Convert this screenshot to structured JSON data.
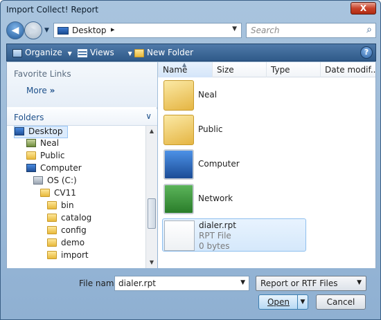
{
  "window": {
    "title": "Import Collect! Report",
    "close_label": "X"
  },
  "nav": {
    "back_glyph": "◀",
    "forward_glyph": "▶",
    "dropdown_glyph": "▼",
    "address": "Desktop",
    "address_separator": "▸",
    "refresh_glyph": "↻",
    "search_placeholder": "Search",
    "search_glyph": "⌕"
  },
  "toolbar": {
    "organize_label": "Organize",
    "views_label": "Views",
    "new_folder_label": "New Folder",
    "menu_glyph": "▼",
    "help_glyph": "?"
  },
  "left": {
    "favorites_title": "Favorite Links",
    "more_label": "More",
    "more_glyph": "»",
    "folders_title": "Folders",
    "folders_chevron": "∨",
    "tree": [
      {
        "label": "Desktop",
        "icon": "desktop-icon"
      },
      {
        "label": "Neal",
        "icon": "user-folder-icon"
      },
      {
        "label": "Public",
        "icon": "folder-icon"
      },
      {
        "label": "Computer",
        "icon": "computer-icon"
      },
      {
        "label": "OS (C:)",
        "icon": "drive-icon"
      },
      {
        "label": "CV11",
        "icon": "folder-icon"
      },
      {
        "label": "bin",
        "icon": "folder-icon"
      },
      {
        "label": "catalog",
        "icon": "folder-icon"
      },
      {
        "label": "config",
        "icon": "folder-icon"
      },
      {
        "label": "demo",
        "icon": "folder-icon"
      },
      {
        "label": "import",
        "icon": "folder-icon"
      }
    ],
    "scroll_up": "▲",
    "scroll_down": "▼"
  },
  "right": {
    "columns": [
      "Name",
      "Size",
      "Type",
      "Date modif..."
    ],
    "sort_glyph": "▲",
    "files": [
      {
        "name": "Neal",
        "icon": "user-folder-icon"
      },
      {
        "name": "Public",
        "icon": "folder-icon"
      },
      {
        "name": "Computer",
        "icon": "computer-icon"
      },
      {
        "name": "Network",
        "icon": "network-icon"
      },
      {
        "name": "dialer.rpt",
        "type": "RPT File",
        "size": "0 bytes",
        "icon": "document-icon"
      }
    ]
  },
  "bottom": {
    "file_name_label": "File name:",
    "file_name_value": "dialer.rpt",
    "file_type_value": "Report or RTF Files",
    "dropdown_glyph": "▼",
    "open_label": "Open",
    "cancel_label": "Cancel"
  }
}
